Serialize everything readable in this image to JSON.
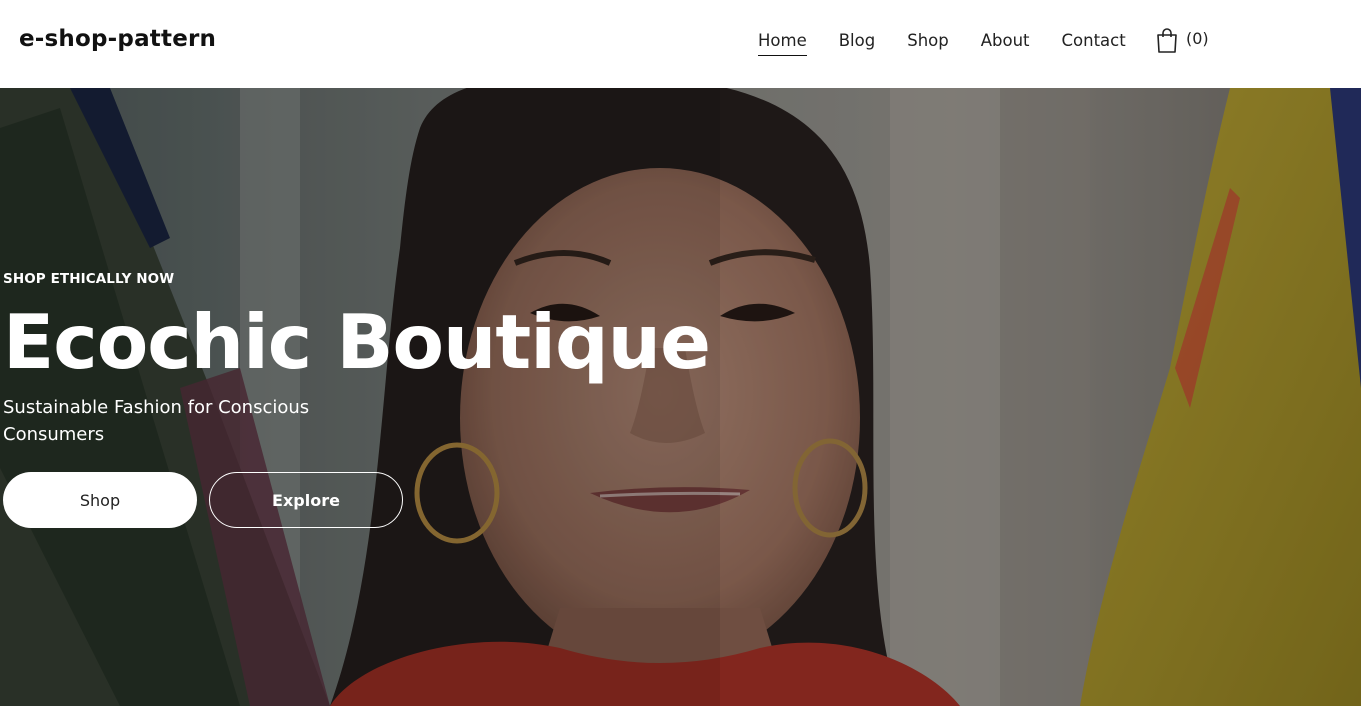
{
  "header": {
    "brand": "e-shop-pattern",
    "nav": [
      {
        "label": "Home",
        "active": true
      },
      {
        "label": "Blog",
        "active": false
      },
      {
        "label": "Shop",
        "active": false
      },
      {
        "label": "About",
        "active": false
      },
      {
        "label": "Contact",
        "active": false
      }
    ],
    "cart": {
      "icon": "shopping-bag-icon",
      "count_label": "(0)"
    }
  },
  "hero": {
    "eyebrow": "SHOP ETHICALLY NOW",
    "title": "Ecochic Boutique",
    "subtitle": "Sustainable Fashion for Conscious Consumers",
    "buttons": {
      "primary": "Shop",
      "secondary": "Explore"
    },
    "image": "woman-smiling-in-clothing-store"
  },
  "colors": {
    "header_bg": "#ffffff",
    "hero_overlay": "#000000",
    "text_on_hero": "#ffffff",
    "sweater": "#b5352a",
    "garment_yellow": "#c9b23a"
  }
}
